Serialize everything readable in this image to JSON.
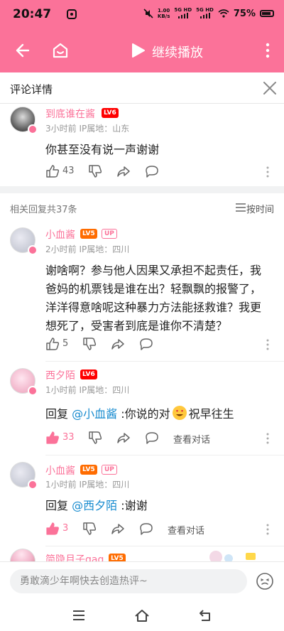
{
  "status_bar": {
    "time": "20:47",
    "net_speed": "1.00",
    "net_unit": "KB/s",
    "sig1": "5G HD",
    "sig2": "5G HD",
    "battery": "75%"
  },
  "header": {
    "continue_play": "继续播放"
  },
  "detail": {
    "title": "评论详情"
  },
  "root_comment": {
    "username": "到底谁在酱",
    "level": "LV6",
    "meta": "3小时前 IP属地：山东",
    "text": "你甚至没有说一声谢谢",
    "likes": "43"
  },
  "replies_header": {
    "count": "相关回复共37条",
    "sort": "按时间"
  },
  "replies": [
    {
      "username": "小血酱",
      "level": "LV5",
      "up": "UP",
      "meta": "2小时前 IP属地：四川",
      "lines": [
        "谢啥啊？参与他人因果又承担不起责任，我",
        "爸妈的机票钱是谁在出？轻飘飘的报警了，",
        "洋洋得意啥呢这种暴力方法能拯救谁？我更",
        "想死了，受害者到底是谁你不清楚？"
      ],
      "likes": "5"
    },
    {
      "username": "西夕陌",
      "level": "LV6",
      "meta": "1小时前 IP属地：四川",
      "reply_prefix": "回复 ",
      "mention": "@小血酱",
      "text": " :你说的对",
      "text_tail": "祝早往生",
      "likes": "33",
      "view_conversation": "查看对话"
    },
    {
      "username": "小血酱",
      "level": "LV5",
      "up": "UP",
      "meta": "1小时前 IP属地：四川",
      "reply_prefix": "回复 ",
      "mention": "@西夕陌",
      "text": " :谢谢",
      "likes": "3",
      "view_conversation": "查看对话"
    },
    {
      "username": "简隐月子gag",
      "level": "LV5"
    }
  ],
  "input": {
    "placeholder": "勇敢滴少年啊快去创造热评~"
  },
  "colors": {
    "brand_pink": "#fb7299",
    "mention_blue": "#178bcf"
  }
}
